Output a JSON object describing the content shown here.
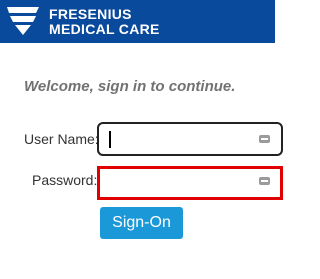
{
  "header": {
    "brand_line_1": "FRESENIUS",
    "brand_line_2": "MEDICAL CARE",
    "logo_icon": "fresenius-logo-icon",
    "background_color": "#0a4a9c"
  },
  "welcome_text": "Welcome, sign in to continue.",
  "form": {
    "username_label": "User Name:",
    "username_value": "",
    "password_label": "Password:",
    "password_value": "",
    "field_icon": "keyboard-icon",
    "password_error_color": "#e00000"
  },
  "signon_button": {
    "label": "Sign-On",
    "color": "#1a98d8"
  }
}
